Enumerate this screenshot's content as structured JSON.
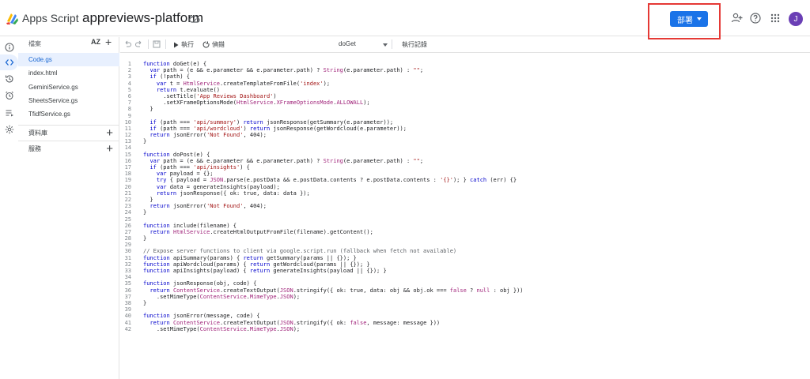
{
  "header": {
    "app_name": "Apps Script",
    "project_name": "appreviews-platform",
    "deploy_label": "部署",
    "avatar_initial": "J",
    "colors": {
      "accent": "#1a73e8",
      "highlight_box": "#e53935",
      "avatar": "#6a3fb5"
    }
  },
  "rail": {
    "items": [
      {
        "icon": "info-icon"
      },
      {
        "icon": "code-icon",
        "active": true
      },
      {
        "icon": "history-icon"
      },
      {
        "icon": "alarm-trigger-icon"
      },
      {
        "icon": "executions-icon"
      },
      {
        "icon": "settings-icon"
      }
    ]
  },
  "files_panel": {
    "title": "檔案",
    "sort_label": "AZ",
    "files": [
      "Code.gs",
      "index.html",
      "GeminiService.gs",
      "SheetsService.gs",
      "TfidfService.gs"
    ],
    "active_file": "Code.gs",
    "sections": [
      "資料庫",
      "服務"
    ]
  },
  "toolbar": {
    "run_label": "執行",
    "debug_label": "偵錯",
    "function_name": "doGet",
    "log_label": "執行記錄"
  },
  "code_lines": [
    "function doGet(e) {",
    "  var path = (e && e.parameter && e.parameter.path) ? String(e.parameter.path) : \"\";",
    "  if (!path) {",
    "    var t = HtmlService.createTemplateFromFile('index');",
    "    return t.evaluate()",
    "      .setTitle('App Reviews Dashboard')",
    "      .setXFrameOptionsMode(HtmlService.XFrameOptionsMode.ALLOWALL);",
    "  }",
    "",
    "  if (path === 'api/summary') return jsonResponse(getSummary(e.parameter));",
    "  if (path === 'api/wordcloud') return jsonResponse(getWordcloud(e.parameter));",
    "  return jsonError('Not Found', 404);",
    "}",
    "",
    "function doPost(e) {",
    "  var path = (e && e.parameter && e.parameter.path) ? String(e.parameter.path) : \"\";",
    "  if (path === 'api/insights') {",
    "    var payload = {};",
    "    try { payload = JSON.parse(e.postData && e.postData.contents ? e.postData.contents : '{}'); } catch (err) {}",
    "    var data = generateInsights(payload);",
    "    return jsonResponse({ ok: true, data: data });",
    "  }",
    "  return jsonError('Not Found', 404);",
    "}",
    "",
    "function include(filename) {",
    "  return HtmlService.createHtmlOutputFromFile(filename).getContent();",
    "}",
    "",
    "// Expose server functions to client via google.script.run (fallback when fetch not available)",
    "function apiSummary(params) { return getSummary(params || {}); }",
    "function apiWordcloud(params) { return getWordcloud(params || {}); }",
    "function apiInsights(payload) { return generateInsights(payload || {}); }",
    "",
    "function jsonResponse(obj, code) {",
    "  return ContentService.createTextOutput(JSON.stringify({ ok: true, data: obj && obj.ok === false ? null : obj }))",
    "    .setMimeType(ContentService.MimeType.JSON);",
    "}",
    "",
    "function jsonError(message, code) {",
    "  return ContentService.createTextOutput(JSON.stringify({ ok: false, message: message }))",
    "    .setMimeType(ContentService.MimeType.JSON);"
  ]
}
